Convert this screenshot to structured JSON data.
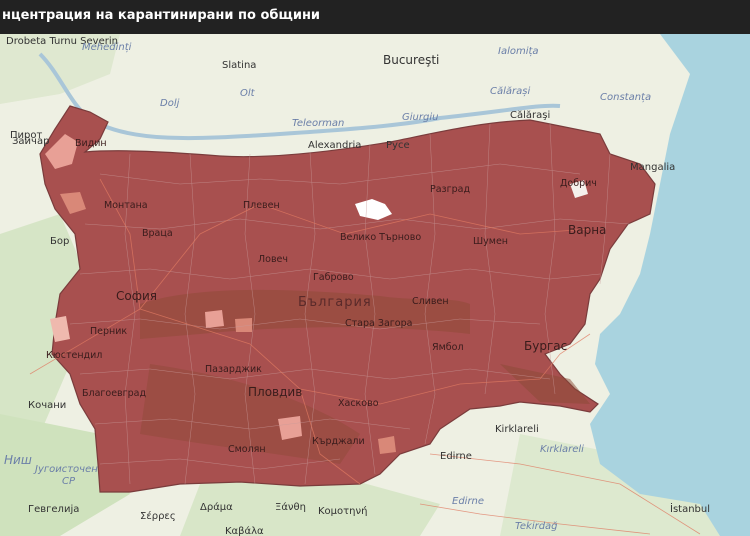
{
  "header": {
    "title": "нцентрация на карантинирани по общини"
  },
  "colors": {
    "fill": "#a8504f",
    "fill_light": "#e8a096",
    "sea": "#a9d3df",
    "land": "#eef0e3",
    "border": "#8b7c9c"
  },
  "map": {
    "country_label": "България",
    "capital": "София",
    "cities_bg": [
      "Видин",
      "Монтана",
      "Враца",
      "Плевен",
      "Ловеч",
      "Велико Търново",
      "Габрово",
      "Разград",
      "Шумен",
      "Добрич",
      "Варна",
      "Перник",
      "Кюстендил",
      "Благоевград",
      "Пазарджик",
      "Пловдив",
      "Стара Загора",
      "Сливен",
      "Ямбол",
      "Бургас",
      "Хасково",
      "Смолян",
      "Кърджали",
      "Зайчар",
      "Пирот",
      "Бор",
      "Кочани"
    ],
    "foreign_places": [
      "Drobeta Turnu Severin",
      "Slatina",
      "Bucureşti",
      "Alexandria",
      "Giurgiu",
      "Călăraşi",
      "Mangalia",
      "Pyce",
      "Kirklareli",
      "Edirne",
      "Σέρρες",
      "Δράμα",
      "Ξάνθη",
      "Κομοτηνή",
      "Καβάλα",
      "Гевгелија",
      "Tekirdağ",
      "İstanbul",
      "Ниш"
    ],
    "regions_italic": [
      "Mehedinți",
      "Ialomița",
      "Dolj",
      "Olt",
      "Teleorman",
      "Giurgiu",
      "Călărași",
      "Constanța",
      "Kırklareli",
      "Edirne",
      "Tekirdağ",
      "Југоисточен",
      "CP",
      "Ниш"
    ]
  }
}
